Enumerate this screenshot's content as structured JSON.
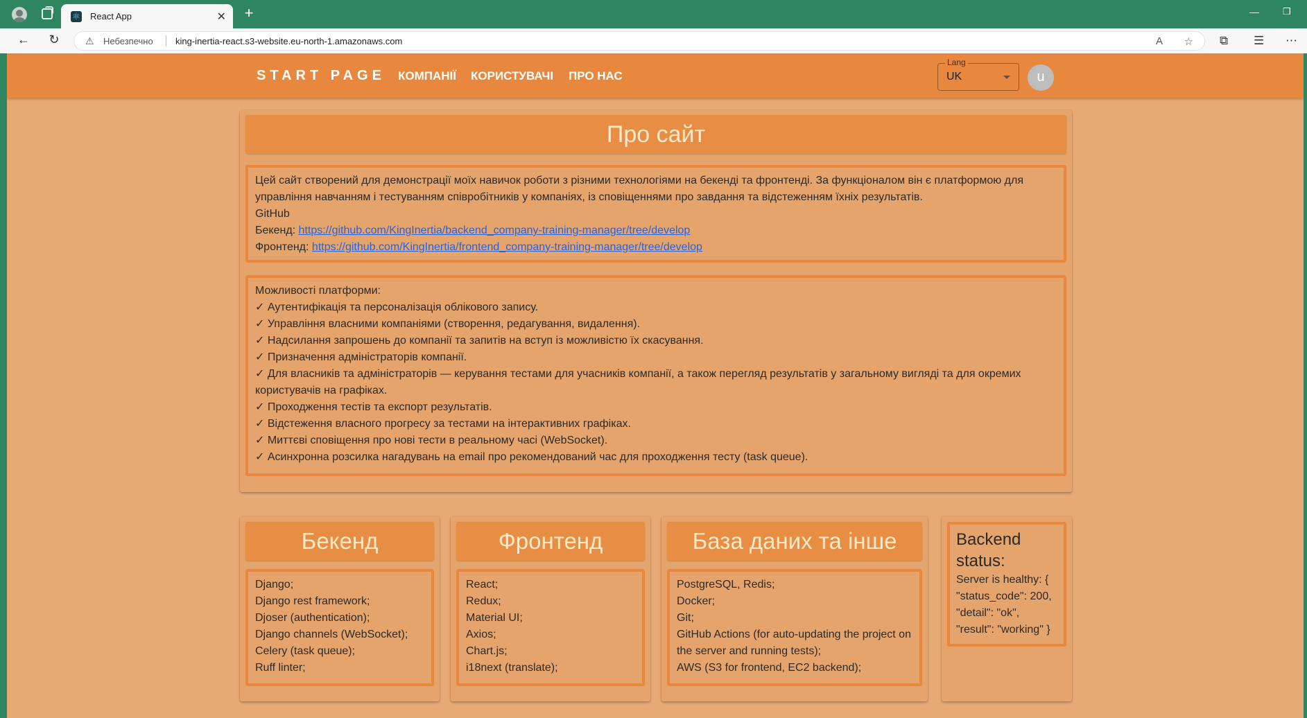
{
  "browser": {
    "tab_title": "React App",
    "security_label": "Небезпечно",
    "url": "king-inertia-react.s3-website.eu-north-1.amazonaws.com"
  },
  "header": {
    "brand": "START PAGE",
    "nav": [
      "КОМПАНІЇ",
      "КОРИСТУВАЧІ",
      "ПРО НАС"
    ],
    "lang_label": "Lang",
    "lang_value": "UK",
    "avatar_letter": "u"
  },
  "about": {
    "title": "Про сайт",
    "intro": "Цей сайт створений для демонстрації моїх навичок роботи з різними технологіями на бекенді та фронтенді. За функціоналом він є платформою для управління навчанням і тестуванням співробітників у компаніях, із сповіщеннями про завдання та відстеженням їхніх результатів.",
    "github_label": "GitHub",
    "backend_label": "Бекенд:",
    "backend_url": "https://github.com/KingInertia/backend_company-training-manager/tree/develop",
    "frontend_label": "Фронтенд:",
    "frontend_url": "https://github.com/KingInertia/frontend_company-training-manager/tree/develop",
    "features_title": "Можливості платформи:",
    "features": [
      "✓ Аутентифікація та персоналізація облікового запису.",
      "✓ Управління власними компаніями (створення, редагування, видалення).",
      "✓ Надсилання запрошень до компанії та запитів на вступ із можливістю їх скасування.",
      "✓ Призначення адміністраторів компанії.",
      "✓ Для власників та адміністраторів — керування тестами для учасників компанії, а також перегляд результатів у загальному вигляді та для окремих користувачів на графіках.",
      "✓ Проходження тестів та експорт результатів.",
      "✓ Відстеження власного прогресу за тестами на інтерактивних графіках.",
      "✓ Миттєві сповіщення про нові тести в реальному часі (WebSocket).",
      "✓ Асинхронна розсилка нагадувань на email про рекомендований час для проходження тесту (task queue)."
    ]
  },
  "stack": {
    "backend": {
      "title": "Бекенд",
      "items": [
        "Django;",
        "Django rest framework;",
        "Djoser (authentication);",
        "Django channels (WebSocket);",
        "Celery (task queue);",
        "Ruff linter;"
      ]
    },
    "frontend": {
      "title": "Фронтенд",
      "items": [
        "React;",
        "Redux;",
        "Material UI;",
        "Axios;",
        "Chart.js;",
        "i18next (translate);"
      ]
    },
    "other": {
      "title": "База даних та інше",
      "items": [
        "PostgreSQL, Redis;",
        "Docker;",
        "Git;",
        "GitHub Actions (for auto-updating the project on the server and running tests);",
        "AWS (S3 for frontend, EC2 backend);"
      ]
    },
    "status": {
      "title": "Backend status:",
      "text": "Server is healthy: { \"status_code\": 200, \"detail\": \"ok\", \"result\": \"working\" }"
    }
  }
}
